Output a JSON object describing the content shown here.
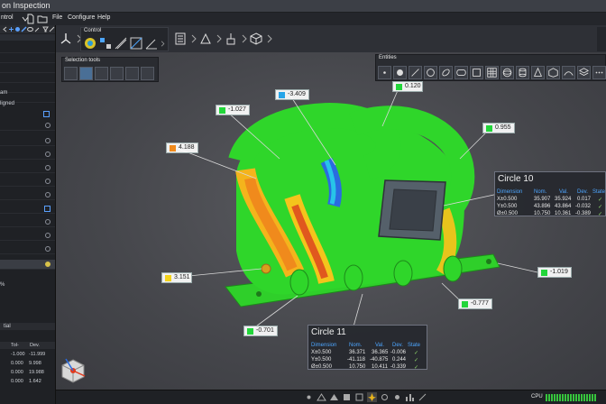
{
  "app": {
    "title": "on Inspection"
  },
  "menubar": {
    "control_label": "ntrol",
    "items": [
      "File",
      "Configure",
      "Help"
    ]
  },
  "left_panel": {
    "row_texts": [
      "am",
      "ligned"
    ],
    "pct": "%",
    "section_label": "tial",
    "table": {
      "headers": [
        "Tol-",
        "Dev."
      ],
      "rows": [
        {
          "tol": "-1.000",
          "dev": "-11.999"
        },
        {
          "tol": "0.000",
          "dev": "9.998"
        },
        {
          "tol": "0.000",
          "dev": "19.988"
        },
        {
          "tol": "0.000",
          "dev": "1.642"
        }
      ]
    }
  },
  "ribbon": {
    "group_label": "Control"
  },
  "selection_tools": {
    "title": "Selection tools"
  },
  "entities": {
    "title": "Entities"
  },
  "callouts": [
    {
      "id": "c1",
      "value": "0.120",
      "color": "#22d63a"
    },
    {
      "id": "c2",
      "value": "-3.409",
      "color": "#27a5e8"
    },
    {
      "id": "c3",
      "value": "-1.027",
      "color": "#22d63a"
    },
    {
      "id": "c4",
      "value": "4.188",
      "color": "#f08a1c"
    },
    {
      "id": "c5",
      "value": "0.955",
      "color": "#22d63a"
    },
    {
      "id": "c6",
      "value": "-1.019",
      "color": "#22d63a"
    },
    {
      "id": "c7",
      "value": "3.151",
      "color": "#f4d31c"
    },
    {
      "id": "c8",
      "value": "-0.777",
      "color": "#22d63a"
    },
    {
      "id": "c9",
      "value": "-0.701",
      "color": "#22d63a"
    }
  ],
  "circle10": {
    "title": "Circle 10",
    "headers": [
      "Dimension",
      "Nom.",
      "Val.",
      "Dev.",
      "State"
    ],
    "rows": [
      {
        "dim": "X±0.500",
        "nom": "35.907",
        "val": "35.924",
        "dev": "0.017",
        "state": "✓"
      },
      {
        "dim": "Y±0.500",
        "nom": "43.896",
        "val": "43.864",
        "dev": "-0.032",
        "state": "✓"
      },
      {
        "dim": "Ø±0.500",
        "nom": "10.750",
        "val": "10.361",
        "dev": "-0.389",
        "state": "✓"
      }
    ]
  },
  "circle11": {
    "title": "Circle 11",
    "headers": [
      "Dimension",
      "Nom.",
      "Val.",
      "Dev.",
      "State"
    ],
    "rows": [
      {
        "dim": "X±0.500",
        "nom": "36.371",
        "val": "36.365",
        "dev": "-0.006",
        "state": "✓"
      },
      {
        "dim": "Y±0.500",
        "nom": "-41.118",
        "val": "-40.875",
        "dev": "0.244",
        "state": "✓"
      },
      {
        "dim": "Ø±0.500",
        "nom": "10.750",
        "val": "10.411",
        "dev": "-0.339",
        "state": "✓"
      }
    ]
  },
  "statusbar": {
    "cpu_label": "CPU"
  },
  "colors": {
    "mesh_green": "#2fd62a",
    "hot_orange": "#f08a1c",
    "hot_red": "#e03a1e",
    "cold_blue": "#2a6be0",
    "accent_blue": "#4da6ff"
  }
}
